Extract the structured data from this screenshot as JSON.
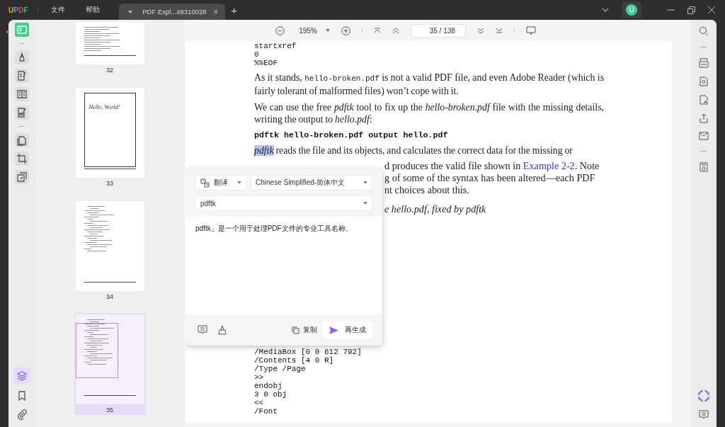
{
  "app": {
    "logo": "UPDF",
    "menus": [
      "文件",
      "帮助"
    ]
  },
  "tabs": [
    {
      "title": "PDF Expl...49310028",
      "selected": true,
      "close": "×"
    }
  ],
  "new_tab": "+",
  "account": {
    "initial": "U"
  },
  "left_tools": [
    {
      "selected": true
    },
    {
      "selected": false
    },
    {
      "selected": false
    },
    {
      "selected": false
    },
    {
      "selected": false
    },
    {
      "selected": false
    },
    {
      "selected": false
    },
    {
      "selected": false
    }
  ],
  "left_bottom_tools": [
    {
      "selected": true
    },
    {
      "selected": false
    },
    {
      "selected": false
    }
  ],
  "thumbnails": [
    {
      "label": "32",
      "kind": "text",
      "selected": false
    },
    {
      "label": "33",
      "kind": "frame",
      "selected": false,
      "caption": "Hello, World!"
    },
    {
      "label": "34",
      "kind": "code",
      "selected": false
    },
    {
      "label": "35",
      "kind": "code",
      "selected": true
    }
  ],
  "toolbar": {
    "zoom": "195%",
    "page": "35 / 138"
  },
  "page": {
    "top_code": [
      "startxref",
      "0",
      "%%EOF"
    ],
    "para1": [
      {
        "t": "As it stands, ",
        "kind": "plain"
      },
      {
        "t": "hello-broken.pdf",
        "kind": "mono"
      },
      {
        "t": " is not a valid PDF file, and even Adobe Reader (which is fairly tolerant of malformed files) won’t cope with it.",
        "kind": "plain"
      }
    ],
    "para2": "We can use the free *pdftk* tool to fix up the *hello-broken.pdf* file with the missing details, writing the output to *hello.pdf*:",
    "command": "pdftk hello-broken.pdf output hello.pdf",
    "para3": [
      {
        "t": "pdftk",
        "kind": "highlight"
      },
      {
        "t": " reads the file and its objects, and calculates the correct data for the missing or",
        "kind": "plain"
      }
    ],
    "partial_lines": [
      {
        "before": "d produces the valid file shown in ",
        "link": "Example 2-2",
        "after": ". Note"
      },
      {
        "before": "g of some of the syntax has been altered—each PDF"
      },
      {
        "before": "nt choices about this."
      }
    ],
    "caption": "e hello.pdf, fixed by pdftk",
    "bottom_code": [
      "/MediaBox [0 0 612 792]",
      "/Contents [4 0 R]",
      "/Type /Page",
      ">>",
      "endobj",
      "3 0 obj",
      "<<",
      "/Font"
    ]
  },
  "popup": {
    "mode": "翻译",
    "language": "Chinese Simplified-简体中文",
    "input": "pdftk",
    "result": "pdftk」是一个用于处理PDF文件的专业工具名称。",
    "copy": "复制",
    "regenerate": "再生成"
  }
}
